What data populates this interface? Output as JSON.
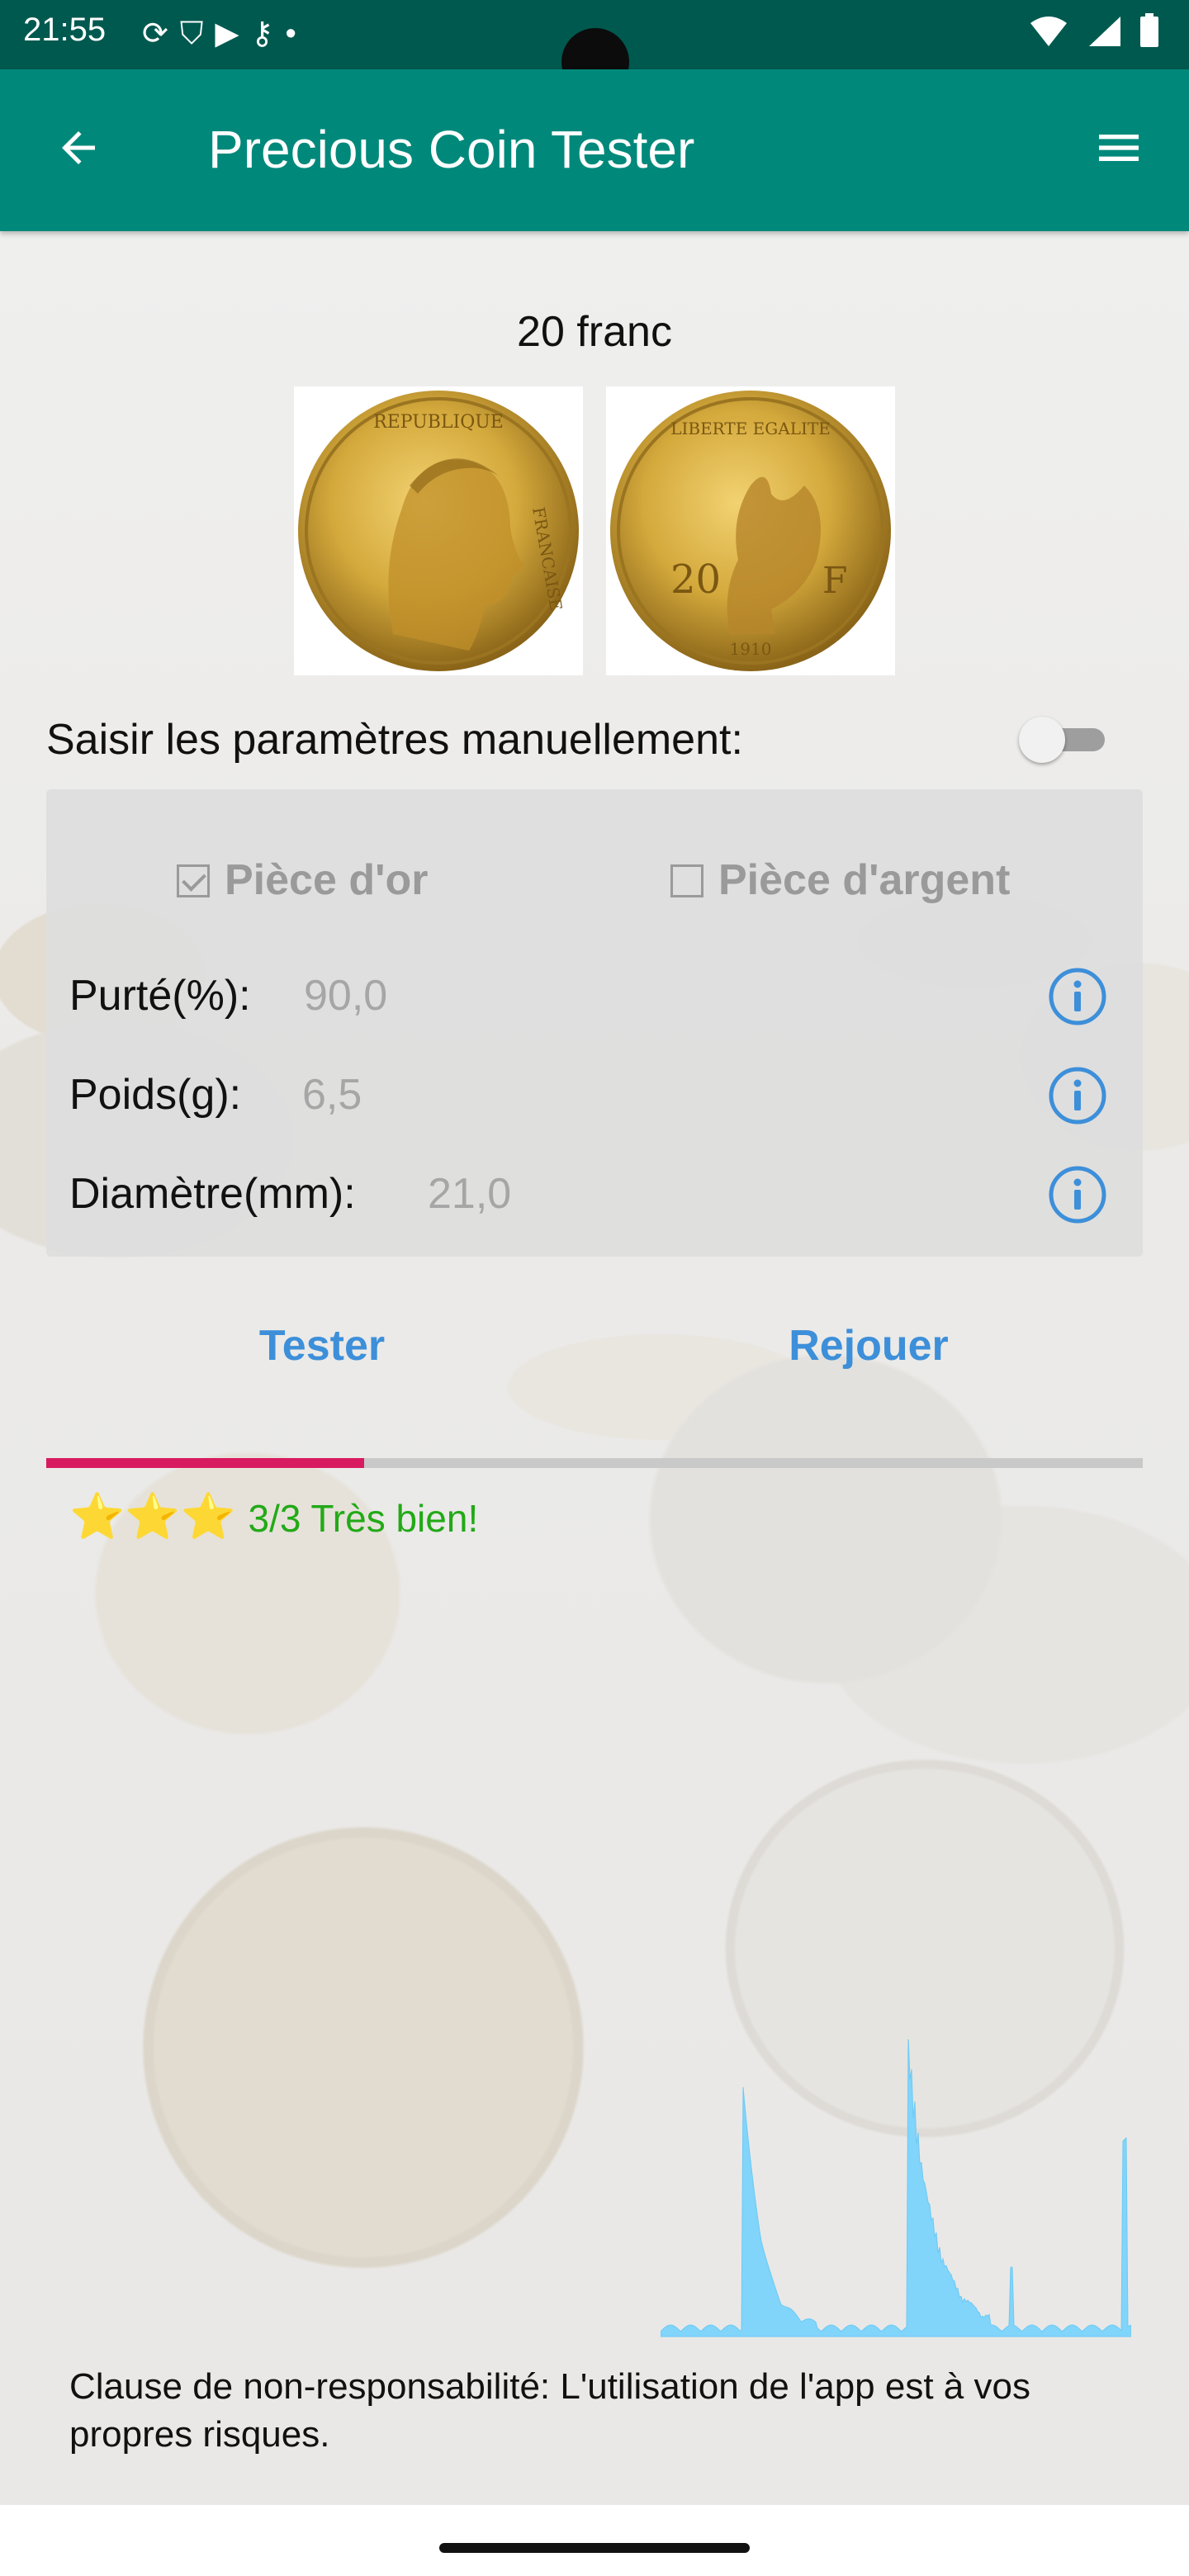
{
  "status_bar": {
    "time": "21:55",
    "icons": [
      "sync-icon",
      "shield-icon",
      "play-protect-icon",
      "vpn-key-icon",
      "dot-icon"
    ],
    "right_icons": [
      "wifi-icon",
      "signal-icon",
      "battery-icon"
    ]
  },
  "app_bar": {
    "title": "Precious Coin Tester",
    "back_icon": "arrow-left-icon",
    "menu_icon": "hamburger-menu-icon"
  },
  "coin": {
    "name": "20 franc",
    "images": [
      "coin-obverse-marianne",
      "coin-reverse-rooster"
    ]
  },
  "manual": {
    "label": "Saisir les paramètres manuellement:",
    "enabled": false
  },
  "panel": {
    "gold_label": "Pièce d'or",
    "gold_checked": true,
    "silver_label": "Pièce d'argent",
    "silver_checked": false,
    "purity_label": "Purté(%):",
    "purity_value": "90,0",
    "weight_label": "Poids(g):",
    "weight_value": "6,5",
    "diameter_label": "Diamètre(mm):",
    "diameter_value": "21,0"
  },
  "actions": {
    "test_label": "Tester",
    "replay_label": "Rejouer"
  },
  "progress": {
    "fraction": 0.29,
    "color": "#d81b60"
  },
  "result": {
    "stars": "⭐⭐⭐",
    "text": "3/3 Très bien!",
    "color": "#23a917"
  },
  "disclaimer": "Clause de non-responsabilité: L'utilisation de l'app est à vos propres risques.",
  "colors": {
    "accent": "#00897b",
    "status_bar": "#00594f",
    "link_blue": "#3d8fd9"
  }
}
